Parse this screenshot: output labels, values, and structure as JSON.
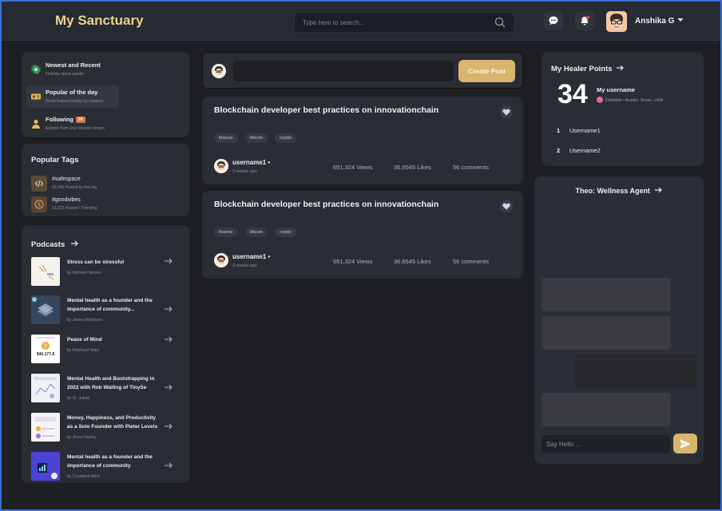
{
  "header": {
    "brand": "My Sanctuary",
    "search_placeholder": "Type here to search...",
    "user_name": "Anshika G"
  },
  "nav": {
    "items": [
      {
        "title": "Newest and Recent",
        "sub": "Find the latest update"
      },
      {
        "title": "Popular of the day",
        "sub": "Shots featured today by curators"
      },
      {
        "title": "Following",
        "sub": "Explore from your favorite person",
        "badge": "24"
      }
    ]
  },
  "tags": {
    "title": "Popular Tags",
    "items": [
      {
        "name": "#safespace",
        "meta": "82,645 Posted by this tag"
      },
      {
        "name": "#goodvibes",
        "meta": "65,523 Posted • Trending"
      }
    ]
  },
  "podcasts": {
    "title": "Podcasts",
    "items": [
      {
        "title": "Stress can be stressful",
        "by": "by Michele Hansen"
      },
      {
        "title": "Mental health as a founder and the importance of community...",
        "by": "by James McKinven"
      },
      {
        "title": "Peace of Mind",
        "by": "by Mahfuzul Nabil"
      },
      {
        "title": "Mental Health and Bootstrapping in 2022 with Rob Walling of TinySe",
        "by": "by Dr. Jubed"
      },
      {
        "title": "Money, Happiness, and Productivity as a Solo Founder with Pieter Levels",
        "by": "by Jesse Hanley"
      },
      {
        "title": "Mental health as a founder and the importance of community",
        "by": "by Courtland Allen"
      }
    ],
    "thumb_price": "$40,177.8"
  },
  "compose": {
    "button": "Create Post"
  },
  "posts": [
    {
      "title": "Blockchain developer best practices on innovationchain",
      "tags": [
        "finance",
        "bitcoin",
        "crypto"
      ],
      "user": "username1 •",
      "time": "3 weeks ago",
      "views": "651,324 Views",
      "likes": "36,6545 Likes",
      "comments": "56 comments"
    },
    {
      "title": "Blockchain developer best practices on innovationchain",
      "tags": [
        "finance",
        "bitcoin",
        "crypto"
      ],
      "user": "username1 •",
      "time": "3 weeks ago",
      "views": "651,324 Views",
      "likes": "36,6545 Likes",
      "comments": "56 comments"
    }
  ],
  "points": {
    "title": "My Healer Points",
    "value": "34",
    "username": "My username",
    "location": "Dribbble • Austin, Texas, USA",
    "ranking": [
      {
        "rank": "1",
        "name": "Username1"
      },
      {
        "rank": "2",
        "name": "Username2"
      }
    ]
  },
  "chat": {
    "title": "Theo: Wellness Agent",
    "placeholder": "Say Hello ...."
  },
  "colors": {
    "accent": "#d9b56d",
    "brand": "#ecd08a",
    "badge": "#e07a3c",
    "background": "#1e1f22",
    "card": "#2a2d34"
  }
}
